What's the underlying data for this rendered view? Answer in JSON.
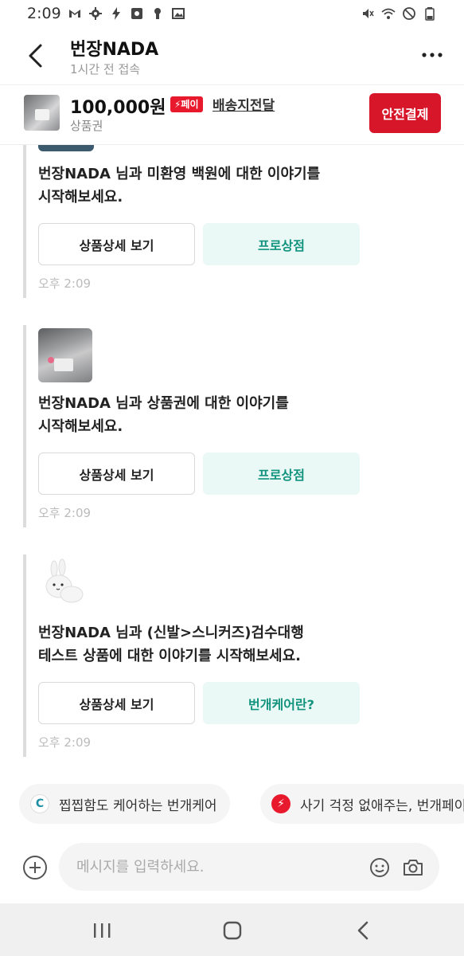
{
  "status_bar": {
    "time": "2:09"
  },
  "header": {
    "shop_name": "번장NADA",
    "last_seen": "1시간 전 접속"
  },
  "product": {
    "price": "100,000원",
    "pay_badge": "⚡페이",
    "delivery_label": "배송지전달",
    "name": "상품권",
    "safe_pay_label": "안전결제"
  },
  "messages": [
    {
      "text": "번장NADA 님과 미환영 백원에 대한 이야기를\n시작해보세요.",
      "detail_label": "상품상세 보기",
      "action_label": "프로상점",
      "time": "오후 2:09"
    },
    {
      "text": "번장NADA 님과 상품권에 대한 이야기를\n시작해보세요.",
      "detail_label": "상품상세 보기",
      "action_label": "프로상점",
      "time": "오후 2:09"
    },
    {
      "text": "번장NADA 님과 (신발>스니커즈)검수대행\n테스트 상품에 대한 이야기를 시작해보세요.",
      "detail_label": "상품상세 보기",
      "action_label": "번개케어란?",
      "time": "오후 2:09"
    }
  ],
  "chips": [
    {
      "label": "찝찝함도 케어하는 번개케어",
      "icon": "C"
    },
    {
      "label": "사기 걱정 없애주는, 번개페이",
      "icon": "⚡"
    }
  ],
  "input": {
    "placeholder": "메시지를 입력하세요."
  },
  "colors": {
    "brand_red": "#d8162a",
    "mint_text": "#12937e",
    "mint_bg": "#eaf8f6"
  }
}
